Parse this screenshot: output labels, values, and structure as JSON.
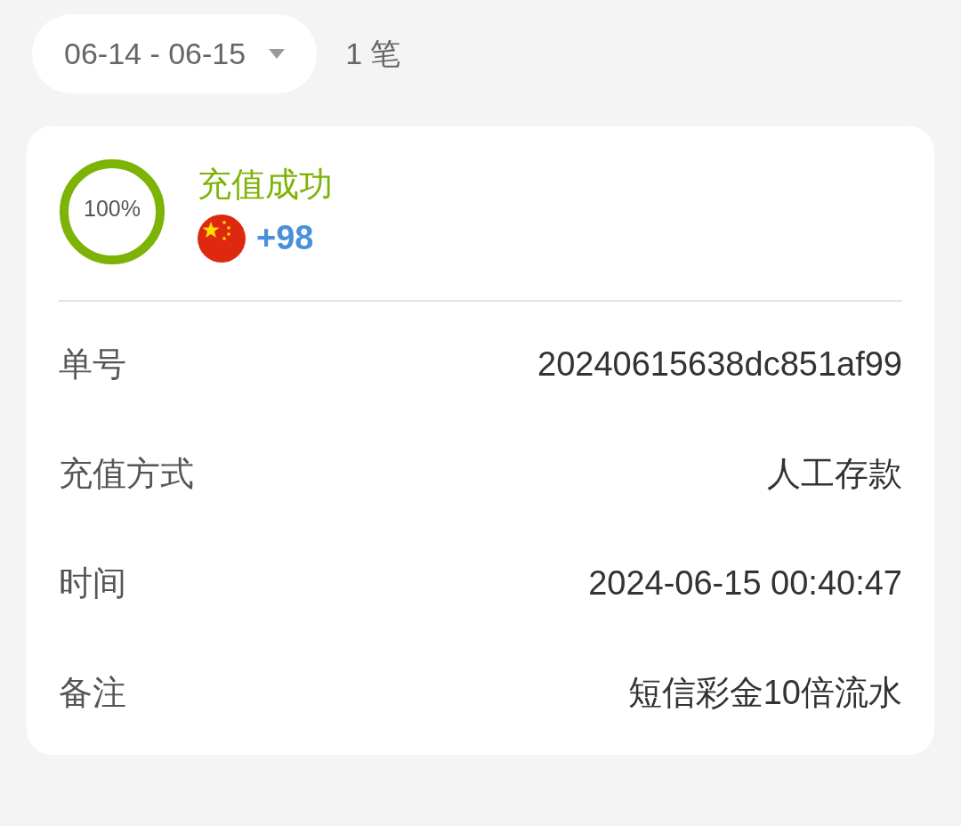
{
  "filter": {
    "date_range": "06-14 - 06-15",
    "count": "1 笔"
  },
  "record": {
    "progress": {
      "level": 1,
      "reading": "100%"
    },
    "status": "充值成功",
    "amount": "+98",
    "fields": [
      {
        "label": "单号",
        "value": "20240615638dc851af99"
      },
      {
        "label": "充值方式",
        "value": "人工存款"
      },
      {
        "label": "时间",
        "value": "2024-06-15 00:40:47"
      },
      {
        "label": "备注",
        "value": "短信彩金10倍流水"
      }
    ]
  }
}
